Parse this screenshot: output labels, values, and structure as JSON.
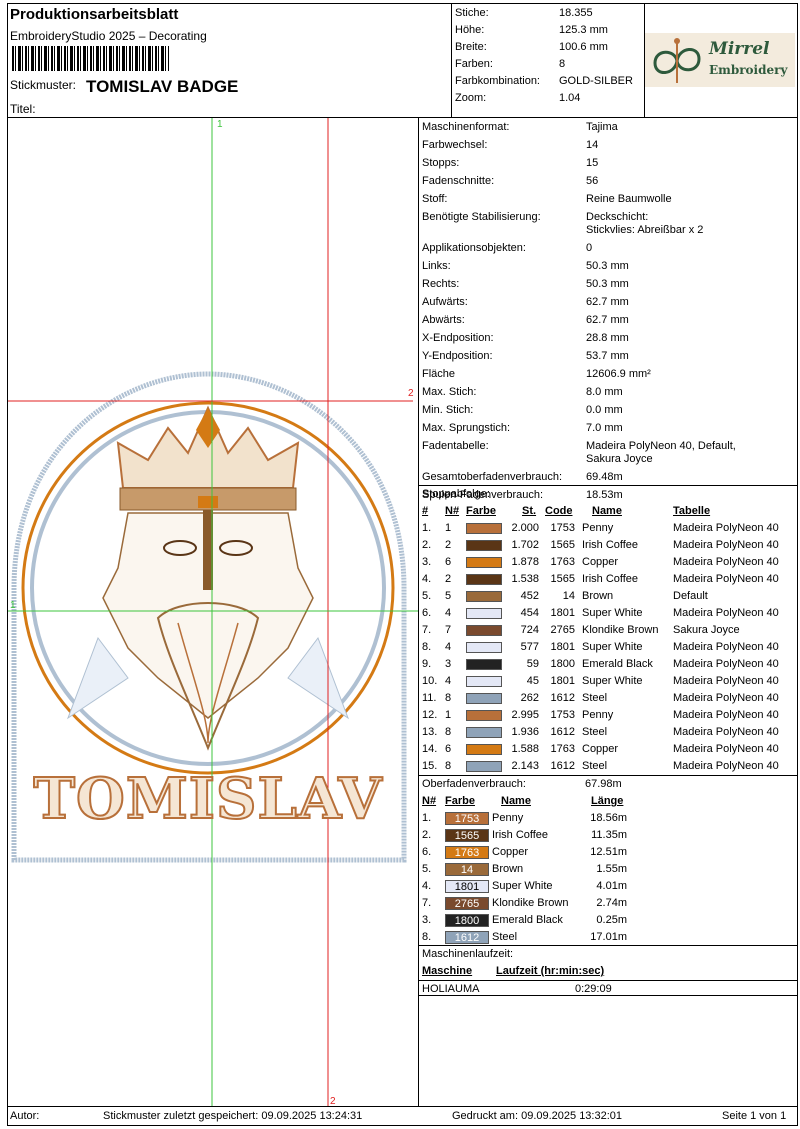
{
  "header": {
    "title": "Produktionsarbeitsblatt",
    "app": "EmbroideryStudio 2025 – Decorating",
    "design_label": "Stickmuster:",
    "design_name": "TOMISLAV BADGE",
    "title_label": "Titel:"
  },
  "summary": [
    {
      "k": "Stiche:",
      "v": "18.355"
    },
    {
      "k": "Höhe:",
      "v": "125.3 mm"
    },
    {
      "k": "Breite:",
      "v": "100.6 mm"
    },
    {
      "k": "Farben:",
      "v": "8"
    },
    {
      "k": "Farbkombination:",
      "v": "GOLD-SILBER"
    },
    {
      "k": "Zoom:",
      "v": "1.04"
    }
  ],
  "logo": {
    "line1": "Mirrel",
    "line2": "Embroidery"
  },
  "guides": {
    "v1": "1",
    "h1": "1",
    "v2": "2",
    "h2": "2"
  },
  "props": [
    {
      "k": "Maschinenformat:",
      "v": "Tajima"
    },
    {
      "k": "Farbwechsel:",
      "v": "14"
    },
    {
      "k": "Stopps:",
      "v": "15"
    },
    {
      "k": "Fadenschnitte:",
      "v": "56"
    },
    {
      "k": "Stoff:",
      "v": "Reine Baumwolle"
    },
    {
      "k": "Benötigte Stabilisierung:",
      "v": "Deckschicht:",
      "v2": "Stickvlies: Abreißbar x 2"
    },
    {
      "k": "Applikationsobjekten:",
      "v": "0"
    },
    {
      "k": "Links:",
      "v": "50.3 mm"
    },
    {
      "k": "Rechts:",
      "v": "50.3 mm"
    },
    {
      "k": "Aufwärts:",
      "v": "62.7 mm"
    },
    {
      "k": "Abwärts:",
      "v": "62.7 mm"
    },
    {
      "k": "X-Endposition:",
      "v": "28.8 mm"
    },
    {
      "k": "Y-Endposition:",
      "v": "53.7 mm"
    },
    {
      "k": "Fläche",
      "v": "12606.9 mm²"
    },
    {
      "k": "Max. Stich:",
      "v": "8.0 mm"
    },
    {
      "k": "Min. Stich:",
      "v": "0.0 mm"
    },
    {
      "k": "Max. Sprungstich:",
      "v": "7.0 mm"
    },
    {
      "k": "Fadentabelle:",
      "v": "Madeira PolyNeon 40, Default,",
      "v2": "Sakura Joyce"
    },
    {
      "k": "Gesamtoberfadenverbrauch:",
      "v": "69.48m"
    },
    {
      "k": "Spulen-Fadenverbrauch:",
      "v": "18.53m"
    }
  ],
  "stops": {
    "title": "Stoppabfolge:",
    "headers": {
      "n": "#",
      "nr": "N#",
      "farbe": "Farbe",
      "st": "St.",
      "code": "Code",
      "name": "Name",
      "tabelle": "Tabelle"
    },
    "rows": [
      {
        "i": "1.",
        "n": "1",
        "color": "#B8703A",
        "st": "2.000",
        "code": "1753",
        "name": "Penny",
        "table": "Madeira PolyNeon 40"
      },
      {
        "i": "2.",
        "n": "2",
        "color": "#5A3516",
        "st": "1.702",
        "code": "1565",
        "name": "Irish Coffee",
        "table": "Madeira PolyNeon 40"
      },
      {
        "i": "3.",
        "n": "6",
        "color": "#D47A14",
        "st": "1.878",
        "code": "1763",
        "name": "Copper",
        "table": "Madeira PolyNeon 40"
      },
      {
        "i": "4.",
        "n": "2",
        "color": "#5A3516",
        "st": "1.538",
        "code": "1565",
        "name": "Irish Coffee",
        "table": "Madeira PolyNeon 40"
      },
      {
        "i": "5.",
        "n": "5",
        "color": "#9A6A3A",
        "st": "452",
        "code": "14",
        "name": "Brown",
        "table": "Default"
      },
      {
        "i": "6.",
        "n": "4",
        "color": "#E4E8F6",
        "st": "454",
        "code": "1801",
        "name": "Super White",
        "table": "Madeira PolyNeon 40"
      },
      {
        "i": "7.",
        "n": "7",
        "color": "#7A4A2E",
        "st": "724",
        "code": "2765",
        "name": "Klondike Brown",
        "table": "Sakura Joyce"
      },
      {
        "i": "8.",
        "n": "4",
        "color": "#E4E8F6",
        "st": "577",
        "code": "1801",
        "name": "Super White",
        "table": "Madeira PolyNeon 40"
      },
      {
        "i": "9.",
        "n": "3",
        "color": "#222222",
        "st": "59",
        "code": "1800",
        "name": "Emerald Black",
        "table": "Madeira PolyNeon 40"
      },
      {
        "i": "10.",
        "n": "4",
        "color": "#E4E8F6",
        "st": "45",
        "code": "1801",
        "name": "Super White",
        "table": "Madeira PolyNeon 40"
      },
      {
        "i": "11.",
        "n": "8",
        "color": "#8FA3B8",
        "st": "262",
        "code": "1612",
        "name": "Steel",
        "table": "Madeira PolyNeon 40"
      },
      {
        "i": "12.",
        "n": "1",
        "color": "#B8703A",
        "st": "2.995",
        "code": "1753",
        "name": "Penny",
        "table": "Madeira PolyNeon 40"
      },
      {
        "i": "13.",
        "n": "8",
        "color": "#8FA3B8",
        "st": "1.936",
        "code": "1612",
        "name": "Steel",
        "table": "Madeira PolyNeon 40"
      },
      {
        "i": "14.",
        "n": "6",
        "color": "#D47A14",
        "st": "1.588",
        "code": "1763",
        "name": "Copper",
        "table": "Madeira PolyNeon 40"
      },
      {
        "i": "15.",
        "n": "8",
        "color": "#8FA3B8",
        "st": "2.143",
        "code": "1612",
        "name": "Steel",
        "table": "Madeira PolyNeon 40"
      }
    ]
  },
  "thread": {
    "title": "Oberfadenverbrauch:",
    "total": "67.98m",
    "headers": {
      "nr": "N#",
      "farbe": "Farbe",
      "name": "Name",
      "len": "Länge"
    },
    "rows": [
      {
        "i": "1.",
        "code": "1753",
        "color": "#B8703A",
        "name": "Penny",
        "len": "18.56m"
      },
      {
        "i": "2.",
        "code": "1565",
        "color": "#5A3516",
        "name": "Irish Coffee",
        "len": "11.35m"
      },
      {
        "i": "6.",
        "code": "1763",
        "color": "#D47A14",
        "name": "Copper",
        "len": "12.51m"
      },
      {
        "i": "5.",
        "code": "14",
        "color": "#9A6A3A",
        "name": "Brown",
        "len": "1.55m"
      },
      {
        "i": "4.",
        "code": "1801",
        "color": "#E4E8F6",
        "name": "Super White",
        "len": "4.01m",
        "dark": true
      },
      {
        "i": "7.",
        "code": "2765",
        "color": "#7A4A2E",
        "name": "Klondike Brown",
        "len": "2.74m"
      },
      {
        "i": "3.",
        "code": "1800",
        "color": "#222222",
        "name": "Emerald Black",
        "len": "0.25m"
      },
      {
        "i": "8.",
        "code": "1612",
        "color": "#8FA3B8",
        "name": "Steel",
        "len": "17.01m"
      }
    ]
  },
  "runtime": {
    "title": "Maschinenlaufzeit:",
    "h_machine": "Maschine",
    "h_time": "Laufzeit (hr:min:sec)",
    "machine": "HOLIAUMA",
    "time": "0:29:09"
  },
  "design_text": "TOMISLAV",
  "footer": {
    "author": "Autor:",
    "saved": "Stickmuster zuletzt gespeichert: 09.09.2025 13:24:31",
    "printed": "Gedruckt am: 09.09.2025 13:32:01",
    "page": "Seite 1 von 1"
  }
}
